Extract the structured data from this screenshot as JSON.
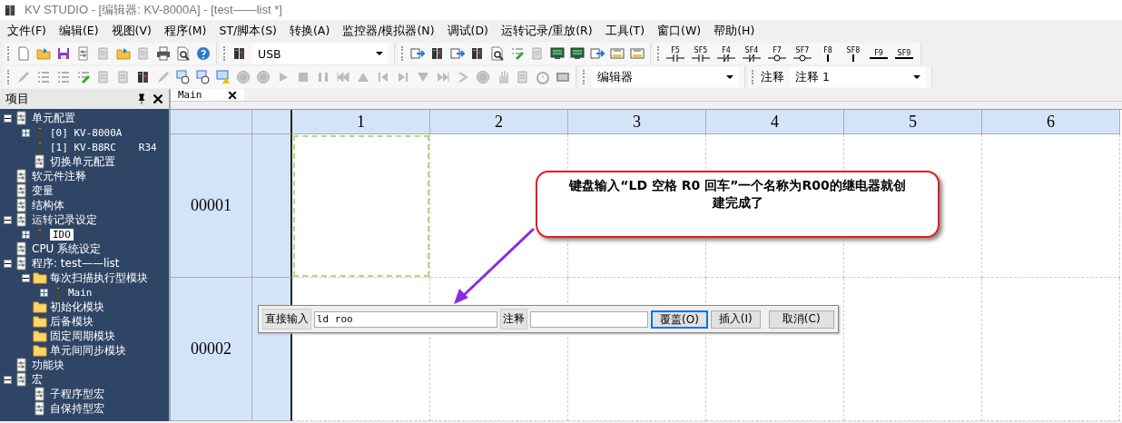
{
  "window": {
    "title": "KV STUDIO - [编辑器: KV-8000A] - [test——list *]"
  },
  "menu": [
    "文件(F)",
    "编辑(E)",
    "视图(V)",
    "程序(M)",
    "ST/脚本(S)",
    "转换(A)",
    "监控器/模拟器(N)",
    "调试(D)",
    "运转记录/重放(R)",
    "工具(T)",
    "窗口(W)",
    "帮助(H)"
  ],
  "toolbar_1": {
    "connection": "USB",
    "fkeys": [
      "F5",
      "SF5",
      "F4",
      "SF4",
      "F7",
      "SF7",
      "F8",
      "SF8",
      "F9",
      "SF9"
    ]
  },
  "toolbar_2": {
    "mode": "编辑器",
    "comment_label": "注释",
    "comment": "注释 1"
  },
  "sidebar": {
    "title": "项目",
    "items": [
      {
        "text": "单元配置",
        "kind": "item",
        "expanded": true,
        "selected": false,
        "children": [
          {
            "text": "[0]  KV-8000A",
            "kind": "unit",
            "expanded": false,
            "selected": false
          },
          {
            "text": "[1]  KV-B8RC",
            "extra": "R34",
            "kind": "unit",
            "selected": false
          },
          {
            "text": "切换单元配置",
            "kind": "item",
            "selected": false
          }
        ]
      },
      {
        "text": "软元件注释",
        "kind": "item",
        "selected": false
      },
      {
        "text": "变量",
        "kind": "item",
        "selected": false
      },
      {
        "text": "结构体",
        "kind": "item",
        "selected": false
      },
      {
        "text": "运转记录设定",
        "kind": "item",
        "expanded": true,
        "selected": false,
        "children": [
          {
            "text": "IDO",
            "kind": "unit",
            "expanded": false,
            "selected": true
          }
        ]
      },
      {
        "text": "CPU 系统设定",
        "kind": "item",
        "selected": false
      },
      {
        "text": "程序: test——list",
        "kind": "item",
        "expanded": true,
        "selected": false,
        "children": [
          {
            "text": "每次扫描执行型模块",
            "kind": "folder",
            "expanded": true,
            "selected": false,
            "children": [
              {
                "text": "Main",
                "kind": "unit",
                "expanded": false,
                "selected": false
              }
            ]
          },
          {
            "text": "初始化模块",
            "kind": "folder",
            "selected": false
          },
          {
            "text": "后备模块",
            "kind": "folder",
            "selected": false
          },
          {
            "text": "固定周期模块",
            "kind": "folder",
            "selected": false
          },
          {
            "text": "单元间同步模块",
            "kind": "folder",
            "selected": false
          }
        ]
      },
      {
        "text": "功能块",
        "kind": "item",
        "selected": false
      },
      {
        "text": "宏",
        "kind": "item",
        "expanded": true,
        "selected": false,
        "children": [
          {
            "text": "子程序型宏",
            "kind": "item",
            "selected": false
          },
          {
            "text": "自保持型宏",
            "kind": "item",
            "selected": false
          }
        ]
      }
    ]
  },
  "editor": {
    "tabs": [
      {
        "label": "Main",
        "selected": true
      }
    ],
    "columns": [
      "1",
      "2",
      "3",
      "4",
      "5",
      "6"
    ],
    "rows": [
      "00001",
      "00002"
    ],
    "input_bar": {
      "label": "直接输入",
      "value": "ld roo",
      "comment_label": "注释",
      "buttons": [
        {
          "label": "覆盖(O)",
          "focused": true
        },
        {
          "label": "插入(I)",
          "focused": false
        },
        {
          "label": "取消(C)",
          "focused": false
        }
      ]
    },
    "callout": "键盘输入“LD 空格  R0  回车”一个名称为R00的继电器就创建完成了"
  }
}
